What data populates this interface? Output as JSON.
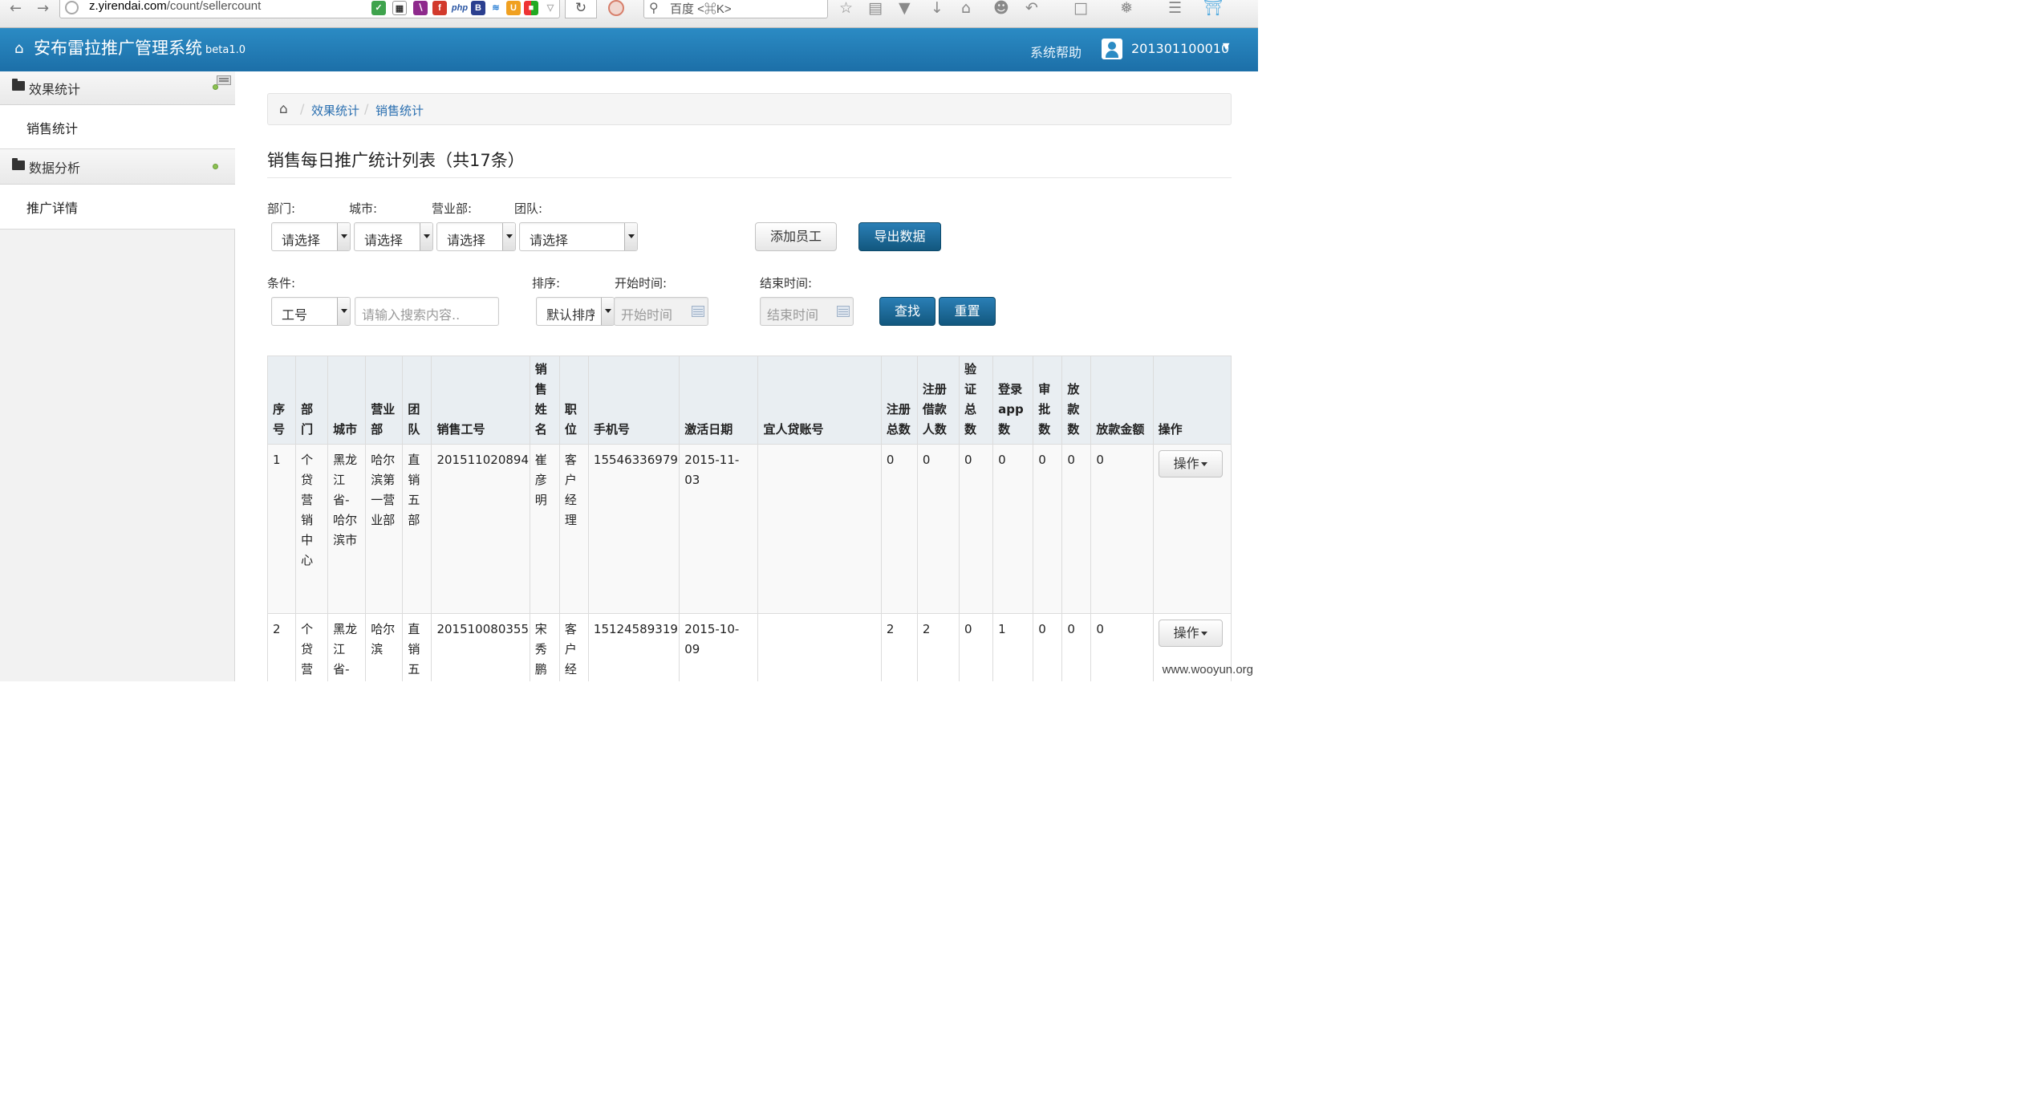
{
  "browser": {
    "url_host": "z.yirendai.com",
    "url_path": "/count/sellercount",
    "search_placeholder": "百度 <⌘K>",
    "ext_php": "php",
    "ext_b": "B"
  },
  "header": {
    "title": "安布雷拉推广管理系统",
    "version": "beta1.0",
    "help": "系统帮助",
    "user": "201301100010"
  },
  "sidebar": {
    "groups": [
      {
        "label": "效果统计",
        "items": [
          "销售统计"
        ]
      },
      {
        "label": "数据分析",
        "items": [
          "推广详情"
        ]
      }
    ]
  },
  "breadcrumb": {
    "items": [
      "效果统计",
      "销售统计"
    ]
  },
  "page_title": "销售每日推广统计列表（共17条）",
  "filters": {
    "dept_label": "部门:",
    "city_label": "城市:",
    "office_label": "营业部:",
    "team_label": "团队:",
    "select_default": "请选择",
    "condition_label": "条件:",
    "condition_value": "工号",
    "search_placeholder": "请输入搜索内容..",
    "sort_label": "排序:",
    "sort_value": "默认排序",
    "start_label": "开始时间:",
    "start_placeholder": "开始时间",
    "end_label": "结束时间:",
    "end_placeholder": "结束时间",
    "add_employee": "添加员工",
    "export": "导出数据",
    "search": "查找",
    "reset": "重置"
  },
  "table": {
    "columns": [
      "序号",
      "部门",
      "城市",
      "营业部",
      "团队",
      "销售工号",
      "销售姓名",
      "职位",
      "手机号",
      "激活日期",
      "宜人贷账号",
      "注册总数",
      "注册借款人数",
      "验证总数",
      "登录app数",
      "审批数",
      "放款数",
      "放款金额",
      "操作"
    ],
    "op_label": "操作",
    "rows": [
      {
        "no": "1",
        "dept": "个贷营销中心",
        "city": "黑龙江省-哈尔滨市",
        "office": "哈尔滨第一营业部",
        "team": "直销五部",
        "emp_id": "201511020894",
        "name": "崔彦明",
        "position": "客户经理",
        "phone": "15546336979",
        "activated": "2015-11-03",
        "account": "",
        "reg_total": "0",
        "reg_borrowers": "0",
        "verified": "0",
        "app_logins": "0",
        "approved": "0",
        "loans": "0",
        "loan_amount": "0"
      },
      {
        "no": "2",
        "dept": "个贷营",
        "city": "黑龙江省-哈",
        "office": "哈尔滨",
        "team": "直销五",
        "emp_id": "201510080355",
        "name": "宋秀鹏",
        "position": "客户经",
        "phone": "15124589319",
        "activated": "2015-10-09",
        "account": "",
        "reg_total": "2",
        "reg_borrowers": "2",
        "verified": "0",
        "app_logins": "1",
        "approved": "0",
        "loans": "0",
        "loan_amount": "0"
      }
    ]
  },
  "watermark": "www.wooyun.org"
}
